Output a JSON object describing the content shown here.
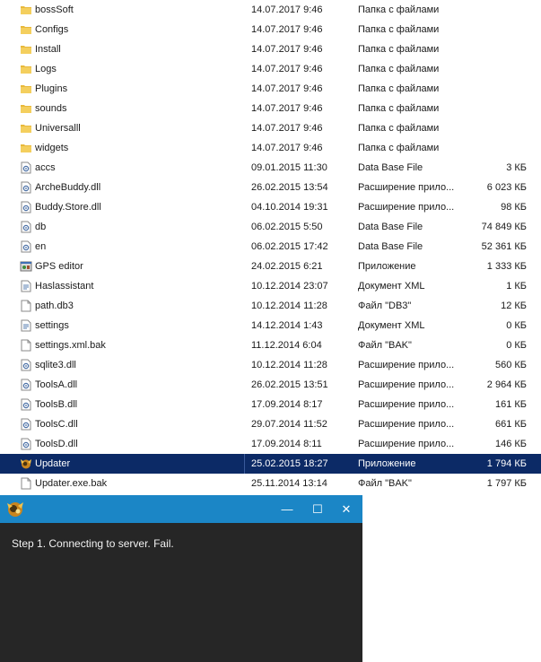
{
  "files": [
    {
      "name": "bossSoft",
      "date": "14.07.2017 9:46",
      "type": "Папка с файлами",
      "size": "",
      "icon": "folder-icon"
    },
    {
      "name": "Configs",
      "date": "14.07.2017 9:46",
      "type": "Папка с файлами",
      "size": "",
      "icon": "folder-icon"
    },
    {
      "name": "Install",
      "date": "14.07.2017 9:46",
      "type": "Папка с файлами",
      "size": "",
      "icon": "folder-icon"
    },
    {
      "name": "Logs",
      "date": "14.07.2017 9:46",
      "type": "Папка с файлами",
      "size": "",
      "icon": "folder-icon"
    },
    {
      "name": "Plugins",
      "date": "14.07.2017 9:46",
      "type": "Папка с файлами",
      "size": "",
      "icon": "folder-icon"
    },
    {
      "name": "sounds",
      "date": "14.07.2017 9:46",
      "type": "Папка с файлами",
      "size": "",
      "icon": "folder-icon"
    },
    {
      "name": "Universalll",
      "date": "14.07.2017 9:46",
      "type": "Папка с файлами",
      "size": "",
      "icon": "folder-icon"
    },
    {
      "name": "widgets",
      "date": "14.07.2017 9:46",
      "type": "Папка с файлами",
      "size": "",
      "icon": "folder-icon"
    },
    {
      "name": "accs",
      "date": "09.01.2015 11:30",
      "type": "Data Base File",
      "size": "3 КБ",
      "icon": "system-file-icon"
    },
    {
      "name": "ArcheBuddy.dll",
      "date": "26.02.2015 13:54",
      "type": "Расширение прило...",
      "size": "6 023 КБ",
      "icon": "system-file-icon"
    },
    {
      "name": "Buddy.Store.dll",
      "date": "04.10.2014 19:31",
      "type": "Расширение прило...",
      "size": "98 КБ",
      "icon": "system-file-icon"
    },
    {
      "name": "db",
      "date": "06.02.2015 5:50",
      "type": "Data Base File",
      "size": "74 849 КБ",
      "icon": "system-file-icon"
    },
    {
      "name": "en",
      "date": "06.02.2015 17:42",
      "type": "Data Base File",
      "size": "52 361 КБ",
      "icon": "system-file-icon"
    },
    {
      "name": "GPS editor",
      "date": "24.02.2015 6:21",
      "type": "Приложение",
      "size": "1 333 КБ",
      "icon": "application-icon"
    },
    {
      "name": "Haslassistant",
      "date": "10.12.2014 23:07",
      "type": "Документ XML",
      "size": "1 КБ",
      "icon": "xml-document-icon"
    },
    {
      "name": "path.db3",
      "date": "10.12.2014 11:28",
      "type": "Файл \"DB3\"",
      "size": "12 КБ",
      "icon": "blank-file-icon"
    },
    {
      "name": "settings",
      "date": "14.12.2014 1:43",
      "type": "Документ XML",
      "size": "0 КБ",
      "icon": "xml-document-icon"
    },
    {
      "name": "settings.xml.bak",
      "date": "11.12.2014 6:04",
      "type": "Файл \"BAK\"",
      "size": "0 КБ",
      "icon": "blank-file-icon"
    },
    {
      "name": "sqlite3.dll",
      "date": "10.12.2014 11:28",
      "type": "Расширение прило...",
      "size": "560 КБ",
      "icon": "system-file-icon"
    },
    {
      "name": "ToolsA.dll",
      "date": "26.02.2015 13:51",
      "type": "Расширение прило...",
      "size": "2 964 КБ",
      "icon": "system-file-icon"
    },
    {
      "name": "ToolsB.dll",
      "date": "17.09.2014 8:17",
      "type": "Расширение прило...",
      "size": "161 КБ",
      "icon": "system-file-icon"
    },
    {
      "name": "ToolsC.dll",
      "date": "29.07.2014 11:52",
      "type": "Расширение прило...",
      "size": "661 КБ",
      "icon": "system-file-icon"
    },
    {
      "name": "ToolsD.dll",
      "date": "17.09.2014 8:11",
      "type": "Расширение прило...",
      "size": "146 КБ",
      "icon": "system-file-icon"
    },
    {
      "name": "Updater",
      "date": "25.02.2015 18:27",
      "type": "Приложение",
      "size": "1 794 КБ",
      "icon": "updater-app-icon",
      "selected": true
    },
    {
      "name": "Updater.exe.bak",
      "date": "25.11.2014 13:14",
      "type": "Файл \"BAK\"",
      "size": "1 797 КБ",
      "icon": "blank-file-icon"
    }
  ],
  "updater": {
    "status": "Step 1. Connecting to server. Fail.",
    "minimize_glyph": "—",
    "maximize_glyph": "☐",
    "close_glyph": "✕",
    "titlebar_color": "#1b86c6",
    "body_color": "#262626"
  },
  "colors": {
    "selection": "#0c2a66",
    "folder": "#e8b93c"
  }
}
